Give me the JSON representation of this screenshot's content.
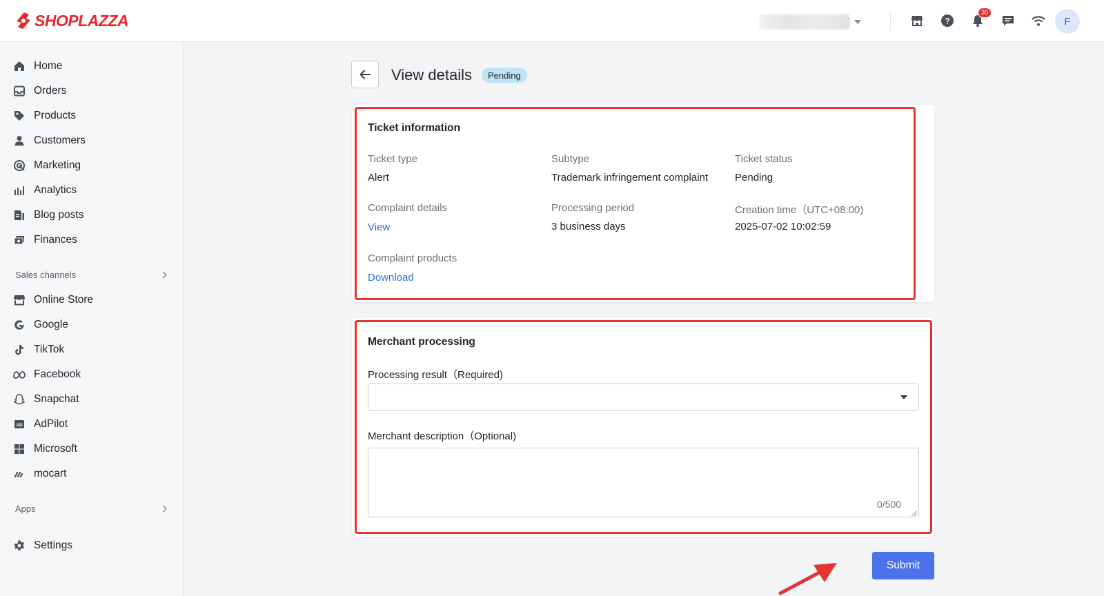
{
  "brand": {
    "name": "SHOPLAZZA",
    "color": "#e8272c"
  },
  "topbar": {
    "notification_count": "30",
    "avatar_initial": "F",
    "icons": [
      "store-icon",
      "help-icon",
      "bell-icon",
      "chat-icon",
      "wifi-icon"
    ]
  },
  "sidebar": {
    "main_items": [
      {
        "label": "Home",
        "icon": "home-icon"
      },
      {
        "label": "Orders",
        "icon": "inbox-icon"
      },
      {
        "label": "Products",
        "icon": "tag-icon"
      },
      {
        "label": "Customers",
        "icon": "person-icon"
      },
      {
        "label": "Marketing",
        "icon": "target-icon"
      },
      {
        "label": "Analytics",
        "icon": "bars-icon"
      },
      {
        "label": "Blog posts",
        "icon": "blog-icon"
      },
      {
        "label": "Finances",
        "icon": "finance-icon"
      }
    ],
    "sales_channels_label": "Sales channels",
    "channels": [
      {
        "label": "Online Store",
        "icon": "store-icon"
      },
      {
        "label": "Google",
        "icon": "google-icon"
      },
      {
        "label": "TikTok",
        "icon": "tiktok-icon"
      },
      {
        "label": "Facebook",
        "icon": "meta-icon"
      },
      {
        "label": "Snapchat",
        "icon": "snapchat-icon"
      },
      {
        "label": "AdPilot",
        "icon": "ad-icon"
      },
      {
        "label": "Microsoft",
        "icon": "microsoft-icon"
      },
      {
        "label": "mocart",
        "icon": "mocart-icon"
      }
    ],
    "apps_label": "Apps",
    "settings_label": "Settings"
  },
  "page": {
    "title": "View details",
    "status": "Pending",
    "status_color": "#bde3f5"
  },
  "ticket": {
    "title": "Ticket information",
    "ticket_type_label": "Ticket type",
    "ticket_type": "Alert",
    "subtype_label": "Subtype",
    "subtype": "Trademark infringement complaint",
    "status_label": "Ticket status",
    "status": "Pending",
    "complaint_details_label": "Complaint details",
    "complaint_details_link": "View",
    "processing_period_label": "Processing period",
    "processing_period": "3 business days",
    "creation_time_label": "Creation time（UTC+08:00)",
    "creation_time": "2025-07-02 10:02:59",
    "complaint_products_label": "Complaint products",
    "complaint_products_link": "Download"
  },
  "merchant": {
    "title": "Merchant processing",
    "result_label": "Processing result（Required)",
    "result_value": "",
    "description_label": "Merchant description（Optional)",
    "description_value": "",
    "counter": "0/500"
  },
  "actions": {
    "submit_label": "Submit",
    "accent": "#4b72ea"
  },
  "highlight_color": "#e5342f"
}
